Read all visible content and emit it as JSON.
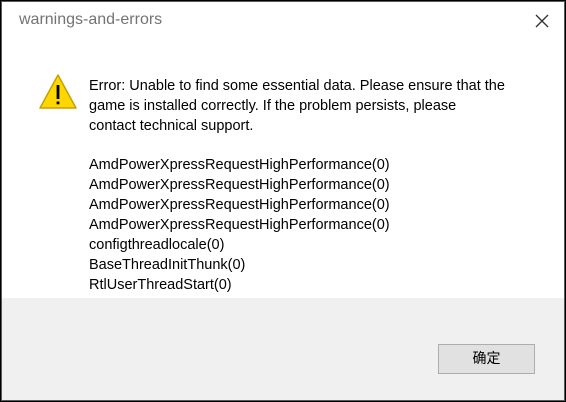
{
  "window": {
    "title": "warnings-and-errors",
    "close_icon": "close-icon"
  },
  "message": {
    "icon": "warning-icon",
    "lines": [
      "Error: Unable to find some essential data. Please ensure that the",
      "game is installed correctly. If the problem persists, please",
      "contact technical support."
    ]
  },
  "stack_trace": [
    "AmdPowerXpressRequestHighPerformance(0)",
    "AmdPowerXpressRequestHighPerformance(0)",
    "AmdPowerXpressRequestHighPerformance(0)",
    "AmdPowerXpressRequestHighPerformance(0)",
    "configthreadlocale(0)",
    "BaseThreadInitThunk(0)",
    "RtlUserThreadStart(0)"
  ],
  "footer": {
    "ok_label": "确定"
  },
  "colors": {
    "warning_fill": "#FFD700",
    "warning_stroke": "#C8A000",
    "footer_bg": "#F0F0F0"
  }
}
